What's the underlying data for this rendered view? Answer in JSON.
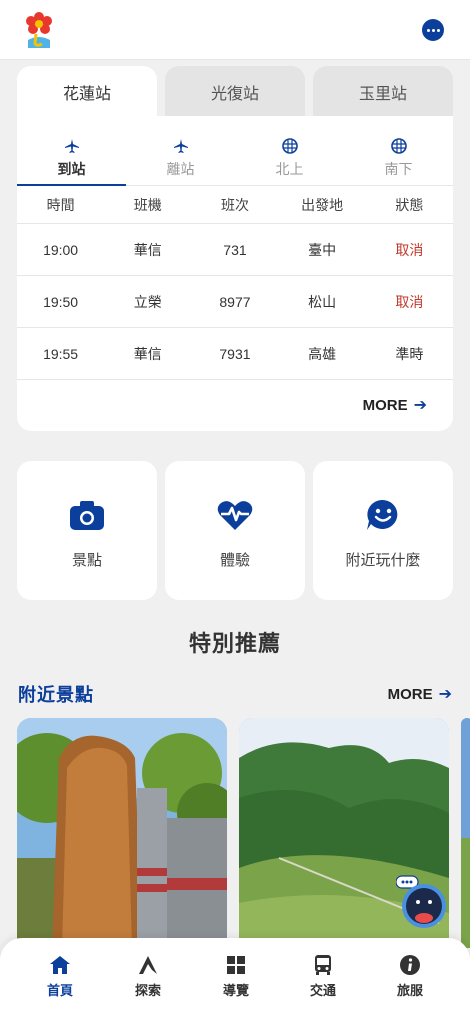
{
  "colors": {
    "brand": "#0c3f9c",
    "cancel": "#c0392b",
    "background": "#f0f0f0"
  },
  "station_tabs": [
    {
      "label": "花蓮站",
      "active": true
    },
    {
      "label": "光復站",
      "active": false
    },
    {
      "label": "玉里站",
      "active": false
    }
  ],
  "mode_tabs": [
    {
      "label": "到站",
      "icon": "plane-icon",
      "active": true
    },
    {
      "label": "離站",
      "icon": "plane-icon",
      "active": false
    },
    {
      "label": "北上",
      "icon": "train-icon",
      "active": false
    },
    {
      "label": "南下",
      "icon": "train-icon",
      "active": false
    }
  ],
  "table": {
    "headers": [
      "時間",
      "班機",
      "班次",
      "出發地",
      "狀態"
    ],
    "rows": [
      [
        "19:00",
        "華信",
        "731",
        "臺中",
        "取消"
      ],
      [
        "19:50",
        "立榮",
        "8977",
        "松山",
        "取消"
      ],
      [
        "19:55",
        "華信",
        "7931",
        "高雄",
        "準時"
      ]
    ],
    "more_label": "MORE"
  },
  "quick_links": [
    {
      "label": "景點",
      "icon": "camera-icon"
    },
    {
      "label": "體驗",
      "icon": "heart-pulse-icon"
    },
    {
      "label": "附近玩什麼",
      "icon": "smile-chat-icon"
    }
  ],
  "special": {
    "title": "特別推薦"
  },
  "nearby": {
    "title": "附近景點",
    "more_label": "MORE"
  },
  "bottom_nav": [
    {
      "label": "首頁",
      "icon": "home-icon",
      "active": true
    },
    {
      "label": "探索",
      "icon": "flag-icon",
      "active": false
    },
    {
      "label": "導覽",
      "icon": "grid-icon",
      "active": false
    },
    {
      "label": "交通",
      "icon": "bus-icon",
      "active": false
    },
    {
      "label": "旅服",
      "icon": "info-icon",
      "active": false
    }
  ]
}
